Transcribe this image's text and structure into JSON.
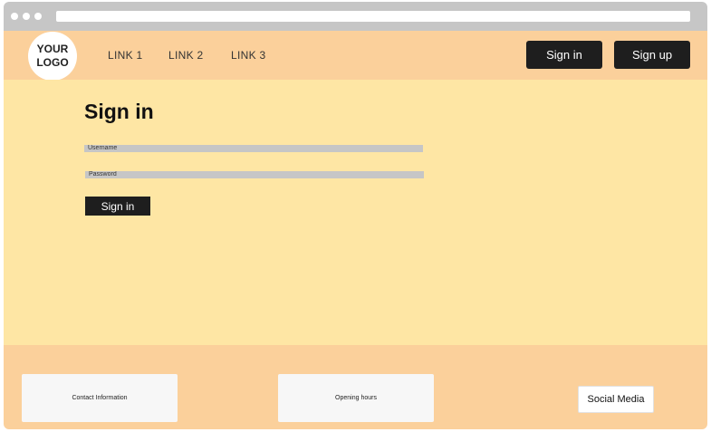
{
  "header": {
    "logo_text": "YOUR LOGO",
    "nav_links": [
      "LINK 1",
      "LINK 2",
      "LINK 3"
    ],
    "signin_label": "Sign in",
    "signup_label": "Sign up"
  },
  "main": {
    "title": "Sign in",
    "username_placeholder": "Username",
    "password_placeholder": "Password",
    "submit_label": "Sign in"
  },
  "footer": {
    "contact_label": "Contact Information",
    "hours_label": "Opening hours",
    "social_label": "Social Media"
  },
  "colors": {
    "header_bg": "#fbd09b",
    "main_bg": "#fee6a4",
    "button_bg": "#1e1e1e",
    "chrome_bg": "#c6c6c6"
  }
}
